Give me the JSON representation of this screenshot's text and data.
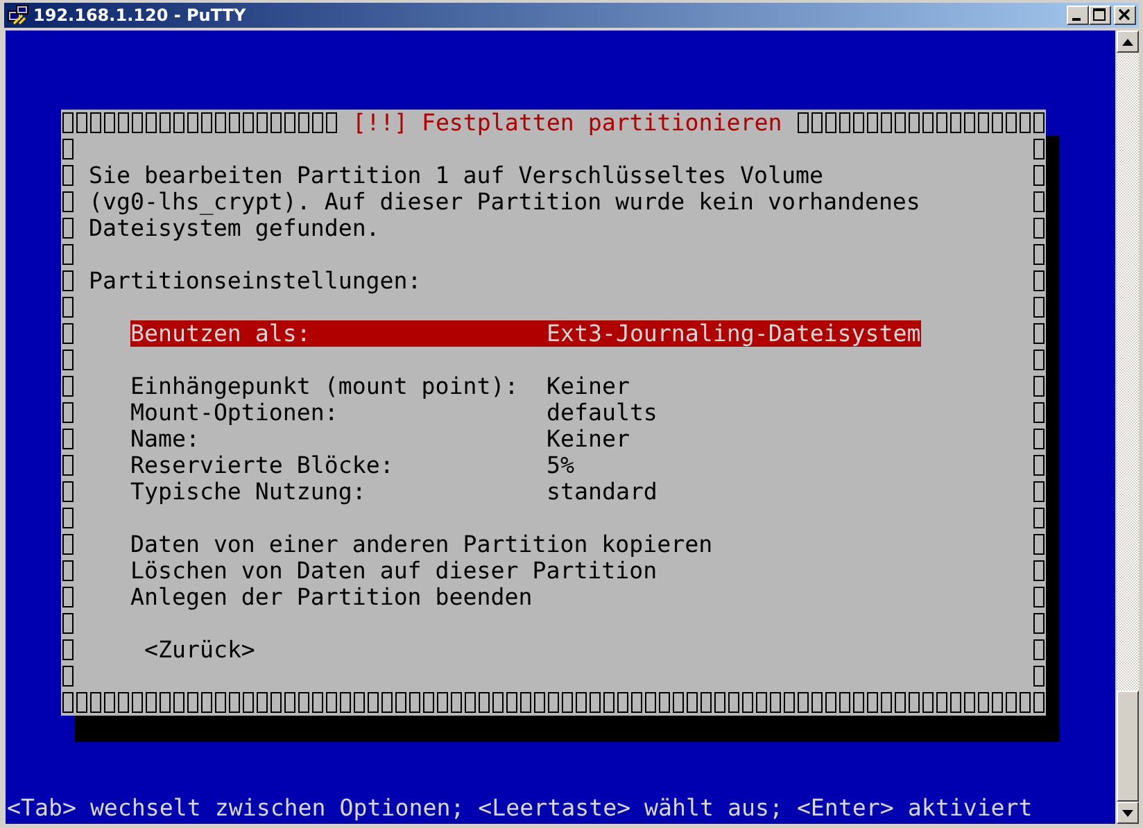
{
  "window": {
    "title": "192.168.1.120 - PuTTY"
  },
  "dialog": {
    "title": "[!!] Festplatten partitionieren",
    "message": [
      "Sie bearbeiten Partition 1 auf Verschlüsseltes Volume",
      "(vg0-lhs_crypt). Auf dieser Partition wurde kein vorhandenes",
      "Dateisystem gefunden."
    ],
    "section_label": "Partitionseinstellungen:",
    "settings": [
      [
        {
          "label": "Benutzen als:",
          "value": "Ext3-Journaling-Dateisystem",
          "selected": true
        }
      ],
      [
        {
          "label": "Einhängepunkt (mount point):",
          "value": "Keiner",
          "selected": false
        },
        {
          "label": "Mount-Optionen:",
          "value": "defaults",
          "selected": false
        },
        {
          "label": "Name:",
          "value": "Keiner",
          "selected": false
        },
        {
          "label": "Reservierte Blöcke:",
          "value": "5%",
          "selected": false
        },
        {
          "label": "Typische Nutzung:",
          "value": "standard",
          "selected": false
        }
      ]
    ],
    "actions": [
      {
        "label": "Daten von einer anderen Partition kopieren",
        "selected": false
      },
      {
        "label": "Löschen von Daten auf dieser Partition",
        "selected": false
      },
      {
        "label": "Anlegen der Partition beenden",
        "selected": false
      }
    ],
    "back_button": {
      "label": "<Zurück>",
      "selected": false
    }
  },
  "status_line": "<Tab> wechselt zwischen Optionen; <Leertaste> wählt aus; <Enter> aktiviert"
}
